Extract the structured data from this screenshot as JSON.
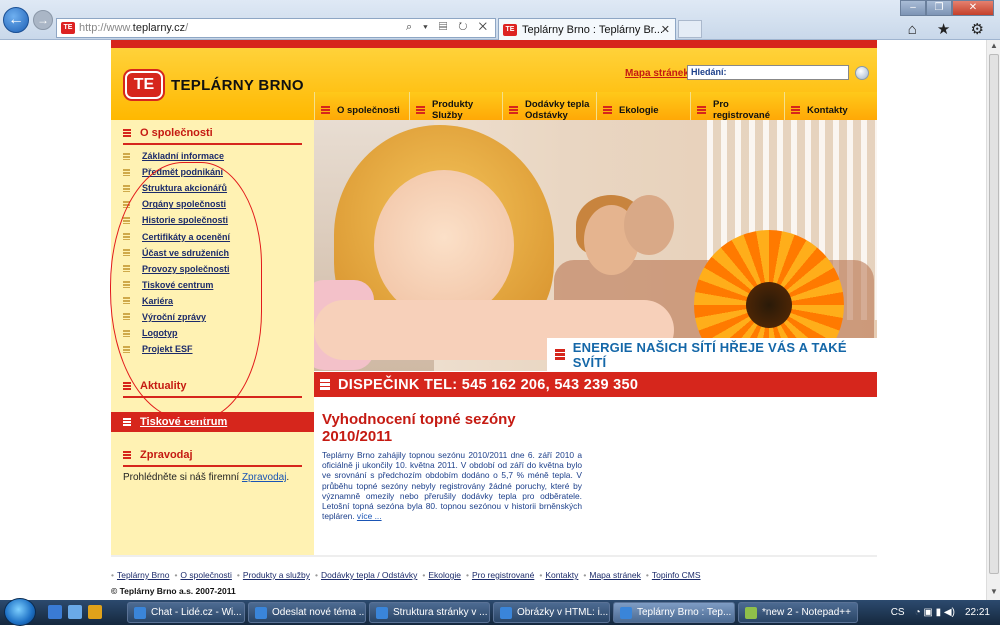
{
  "browser": {
    "url_prefix": "http://www.",
    "url_host": "teplarny.cz",
    "url_suffix": "/",
    "address_tools": "⌕ ▾ ▤ ↻ ✕",
    "tab_title": "Teplárny Brno : Teplárny Br...",
    "tab_close": "✕",
    "back_glyph": "←",
    "forward_glyph": "→",
    "window_controls": [
      "–",
      "❐",
      "✕"
    ],
    "right_icons": "⌂ ★ ⚙"
  },
  "site": {
    "logo_mark": "TE",
    "logo_text": "TEPLÁRNY BRNO",
    "sitemap_link": "Mapa stránek",
    "search_label": "Hledání:",
    "menu": [
      {
        "label": "O společnosti"
      },
      {
        "label": "Produkty\nSlužby"
      },
      {
        "label": "Dodávky tepla\nOdstávky"
      },
      {
        "label": "Ekologie"
      },
      {
        "label": "Pro registrované"
      },
      {
        "label": "Kontakty"
      }
    ],
    "left": {
      "section_title": "O společnosti",
      "items": [
        "Základní informace",
        "Předmět podnikání",
        "Struktura akcionářů",
        "Orgány společnosti",
        "Historie společnosti",
        "Certifikáty a ocenění",
        "Účast ve sdruženích",
        "Provozy společnosti",
        "Tiskové centrum",
        "Kariéra",
        "Výroční zprávy",
        "Logotyp",
        "Projekt ESF"
      ],
      "news_title": "Aktuality",
      "press_title": "Tiskové centrum",
      "newsletter_title": "Zpravodaj",
      "newsletter_text": "Prohlédněte si náš firemní ",
      "newsletter_link": "Zpravodaj",
      "newsletter_end": "."
    },
    "hero_slogan": "ENERGIE NAŠICH SÍTÍ HŘEJE VÁS A TAKÉ SVÍTÍ",
    "dispatch": "DISPEČINK TEL: 545 162 206, 543 239 350",
    "article": {
      "title": "Vyhodnocení topné sezóny 2010/2011",
      "text": "Teplárny Brno zahájily topnou sezónu 2010/2011 dne 6. září 2010 a oficiálně ji ukončily 10. května 2011. V období od září do května bylo ve srovnání s předchozím obdobím dodáno o 5,7 % méně tepla. V průběhu topné sezóny nebyly registrovány žádné poruchy, které by významně omezily nebo přerušily dodávky tepla pro odběratele. Letošní topná sezóna byla 80. topnou sezónou v historii brněnských tepláren.",
      "more": "více ..."
    },
    "footer_links": [
      "Teplárny Brno",
      "O společnosti",
      "Produkty a služby",
      "Dodávky tepla / Odstávky",
      "Ekologie",
      "Pro registrované",
      "Kontakty",
      "Mapa stránek",
      "Topinfo CMS"
    ],
    "copyright": "© Teplárny Brno a.s. 2007-2011"
  },
  "taskbar": {
    "tasks": [
      "Chat - Lidé.cz - Wi...",
      "Odeslat nové téma ...",
      "Struktura stránky v ...",
      "Obrázky v HTML: i...",
      "Teplárny Brno : Tep...",
      "*new 2 - Notepad++"
    ],
    "lang": "CS",
    "time": "22:21"
  },
  "colors": {
    "brand_red": "#d6261c",
    "brand_yellow": "#ffb800",
    "link_blue": "#1c2b6a",
    "slogan_blue": "#1467a8"
  }
}
